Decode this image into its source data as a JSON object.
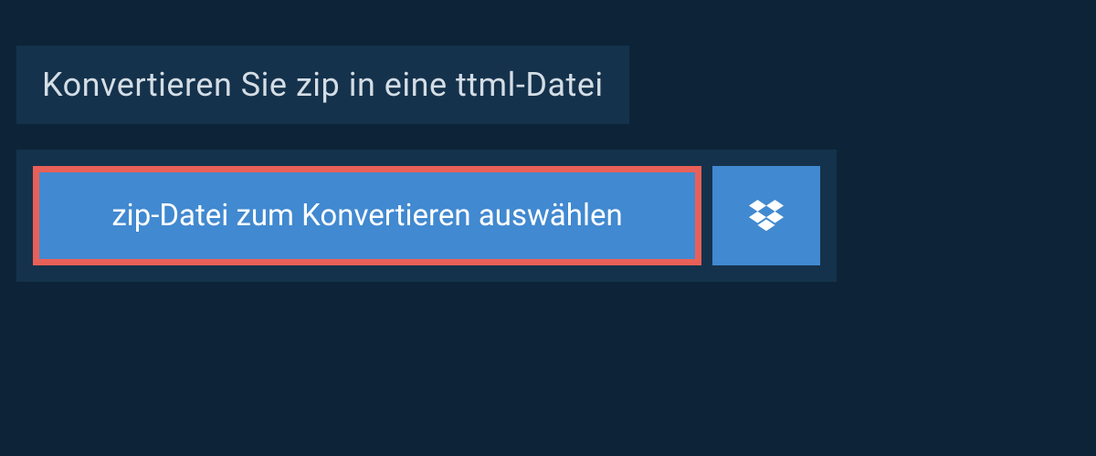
{
  "header": {
    "title": "Konvertieren Sie zip in eine ttml-Datei"
  },
  "upload": {
    "select_label": "zip-Datei zum Konvertieren auswählen",
    "dropbox_icon": "dropbox"
  },
  "colors": {
    "background": "#0d2438",
    "panel": "#15324c",
    "button": "#4189d0",
    "highlight_border": "#e86058",
    "text_light": "#d4dde5",
    "text_white": "#ffffff"
  }
}
